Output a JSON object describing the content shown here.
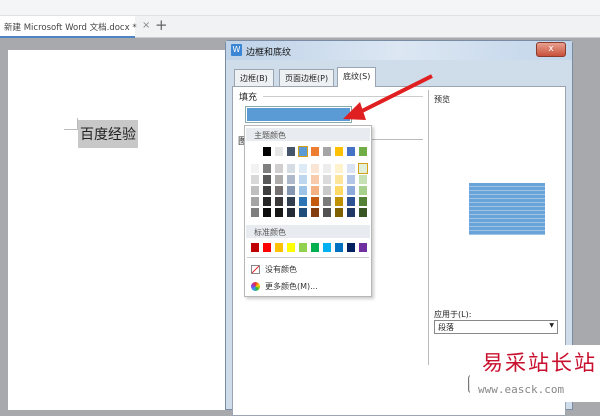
{
  "tab": {
    "title": "新建 Microsoft Word 文档.docx *",
    "close": "×",
    "add": "+"
  },
  "document": {
    "text": "百度经验"
  },
  "dialog": {
    "title": "边框和底纹",
    "icon": "W",
    "close": "x",
    "tabs": [
      {
        "label": "边框(B)"
      },
      {
        "label": "页面边框(P)"
      },
      {
        "label": "底纹(S)",
        "active": true
      }
    ],
    "fill_label": "填充",
    "fill_color": "#5b9bd5",
    "pattern_label": "图",
    "preview_label": "预览",
    "apply_label": "应用于(L):",
    "apply_value": "段落",
    "ok_label": "确"
  },
  "palette": {
    "theme_header": "主题颜色",
    "theme_colors": [
      "#ffffff",
      "#000000",
      "#e7e6e6",
      "#44546a",
      "#5b9bd5",
      "#ed7d31",
      "#a5a5a5",
      "#ffc000",
      "#4472c4",
      "#70ad47"
    ],
    "shades": [
      [
        "#f2f2f2",
        "#7f7f7f",
        "#d0cece",
        "#d6dce4",
        "#deebf6",
        "#fbe5d5",
        "#ededed",
        "#fff2cc",
        "#dae3f3",
        "#e2efd9"
      ],
      [
        "#d8d8d8",
        "#595959",
        "#aeabab",
        "#adb9ca",
        "#bdd7ee",
        "#f7cbac",
        "#dbdbdb",
        "#fee599",
        "#b4c6e7",
        "#c5e0b3"
      ],
      [
        "#bfbfbf",
        "#3f3f3f",
        "#757070",
        "#8496b0",
        "#9dc3e6",
        "#f4b183",
        "#c9c9c9",
        "#ffd965",
        "#8eaadb",
        "#a8d08d"
      ],
      [
        "#a5a5a5",
        "#262626",
        "#3a3838",
        "#323f4f",
        "#2e75b5",
        "#c55a11",
        "#7b7b7b",
        "#bf9000",
        "#2f5496",
        "#538135"
      ],
      [
        "#7f7f7f",
        "#0c0c0c",
        "#171616",
        "#222a35",
        "#1e4e79",
        "#833c0b",
        "#525252",
        "#7f6000",
        "#1f3864",
        "#375623"
      ]
    ],
    "standard_header": "标准颜色",
    "standard_colors": [
      "#c00000",
      "#ff0000",
      "#ffc000",
      "#ffff00",
      "#92d050",
      "#00b050",
      "#00b0f0",
      "#0070c0",
      "#002060",
      "#7030a0"
    ],
    "no_color": "没有颜色",
    "more_colors": "更多颜色(M)..."
  },
  "annotation": {
    "arrow_color": "#e02020"
  },
  "watermark": {
    "cn": "易采站长站",
    "url": "www.easck.com"
  }
}
